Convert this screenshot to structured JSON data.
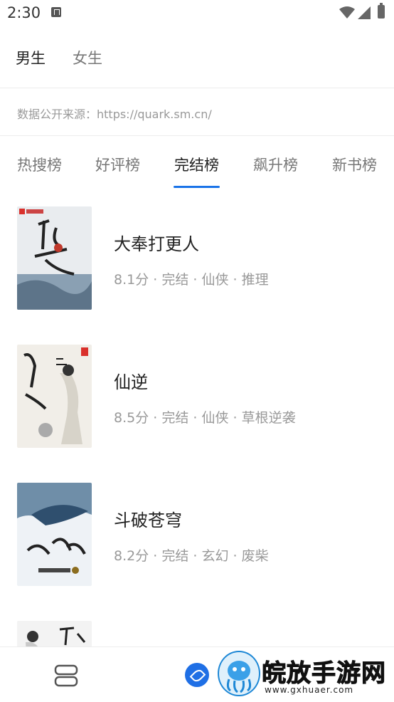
{
  "status_bar": {
    "time": "2:30"
  },
  "gender_tabs": [
    {
      "label": "男生",
      "active": true
    },
    {
      "label": "女生",
      "active": false
    }
  ],
  "source_text": "数据公开来源：https://quark.sm.cn/",
  "rank_tabs": [
    {
      "label": "热搜榜",
      "active": false
    },
    {
      "label": "好评榜",
      "active": false
    },
    {
      "label": "完结榜",
      "active": true
    },
    {
      "label": "飙升榜",
      "active": false
    },
    {
      "label": "新书榜",
      "active": false
    }
  ],
  "books": [
    {
      "title": "大奉打更人",
      "meta": "8.1分 · 完结 · 仙侠 · 推理"
    },
    {
      "title": "仙逆",
      "meta": "8.5分 · 完结 · 仙侠 · 草根逆袭"
    },
    {
      "title": "斗破苍穹",
      "meta": "8.2分 · 完结 · 玄幻 · 废柴"
    },
    {
      "title": "",
      "meta": ""
    }
  ],
  "bottom_bar": {
    "tabs_icon": "tabs-icon",
    "compass_icon": "compass-icon"
  },
  "watermark": {
    "title": "皖放手游网",
    "url": "www.gxhuaer.com"
  },
  "colors": {
    "accent": "#1a73e8",
    "muted": "#999999"
  }
}
